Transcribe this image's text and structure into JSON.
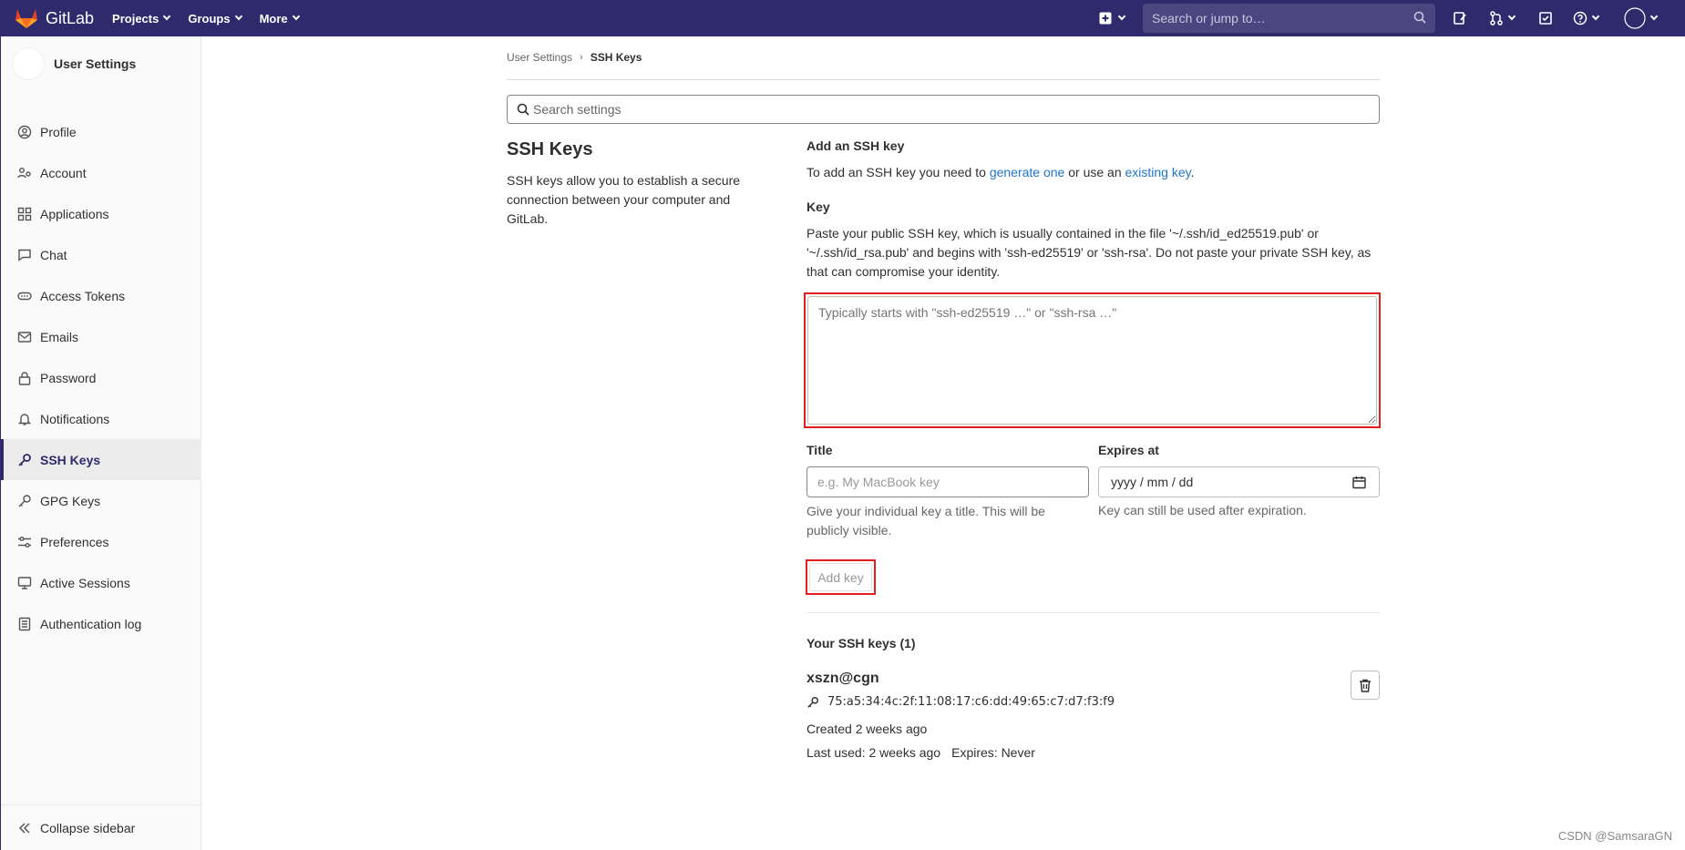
{
  "topbar": {
    "brand": "GitLab",
    "nav": [
      {
        "label": "Projects"
      },
      {
        "label": "Groups"
      },
      {
        "label": "More"
      }
    ],
    "search_placeholder": "Search or jump to…"
  },
  "sidebar": {
    "title": "User Settings",
    "items": [
      {
        "label": "Profile",
        "icon": "profile-icon"
      },
      {
        "label": "Account",
        "icon": "account-icon"
      },
      {
        "label": "Applications",
        "icon": "applications-icon"
      },
      {
        "label": "Chat",
        "icon": "chat-icon"
      },
      {
        "label": "Access Tokens",
        "icon": "token-icon"
      },
      {
        "label": "Emails",
        "icon": "mail-icon"
      },
      {
        "label": "Password",
        "icon": "lock-icon"
      },
      {
        "label": "Notifications",
        "icon": "bell-icon"
      },
      {
        "label": "SSH Keys",
        "icon": "key-icon",
        "active": true
      },
      {
        "label": "GPG Keys",
        "icon": "key-icon"
      },
      {
        "label": "Preferences",
        "icon": "preferences-icon"
      },
      {
        "label": "Active Sessions",
        "icon": "monitor-icon"
      },
      {
        "label": "Authentication log",
        "icon": "log-icon"
      }
    ],
    "collapse_label": "Collapse sidebar"
  },
  "breadcrumb": {
    "parent": "User Settings",
    "current": "SSH Keys"
  },
  "settings_search_placeholder": "Search settings",
  "section": {
    "title": "SSH Keys",
    "description": "SSH keys allow you to establish a secure connection between your computer and GitLab."
  },
  "add_key": {
    "title": "Add an SSH key",
    "desc_prefix": "To add an SSH key you need to ",
    "link_generate": "generate one",
    "desc_middle": " or use an ",
    "link_existing": "existing key",
    "desc_suffix": ".",
    "key_label": "Key",
    "key_help": "Paste your public SSH key, which is usually contained in the file '~/.ssh/id_ed25519.pub' or '~/.ssh/id_rsa.pub' and begins with 'ssh-ed25519' or 'ssh-rsa'. Do not paste your private SSH key, as that can compromise your identity.",
    "key_placeholder": "Typically starts with \"ssh-ed25519 …\" or \"ssh-rsa …\"",
    "title_label": "Title",
    "title_placeholder": "e.g. My MacBook key",
    "title_help": "Give your individual key a title. This will be publicly visible.",
    "expires_label": "Expires at",
    "expires_placeholder": "yyyy / mm / dd",
    "expires_help": "Key can still be used after expiration.",
    "button_label": "Add key"
  },
  "your_keys": {
    "heading": "Your SSH keys (1)",
    "keys": [
      {
        "name": "xszn@cgn",
        "fingerprint": "75:a5:34:4c:2f:11:08:17:c6:dd:49:65:c7:d7:f3:f9",
        "created": "Created 2 weeks ago",
        "last_used": "Last used: 2 weeks ago",
        "expires": "Expires: Never"
      }
    ]
  },
  "watermark": "CSDN @SamsaraGN",
  "colors": {
    "topbar": "#2f2a6b",
    "link": "#1f75cb",
    "highlight_box": "#e02020"
  }
}
